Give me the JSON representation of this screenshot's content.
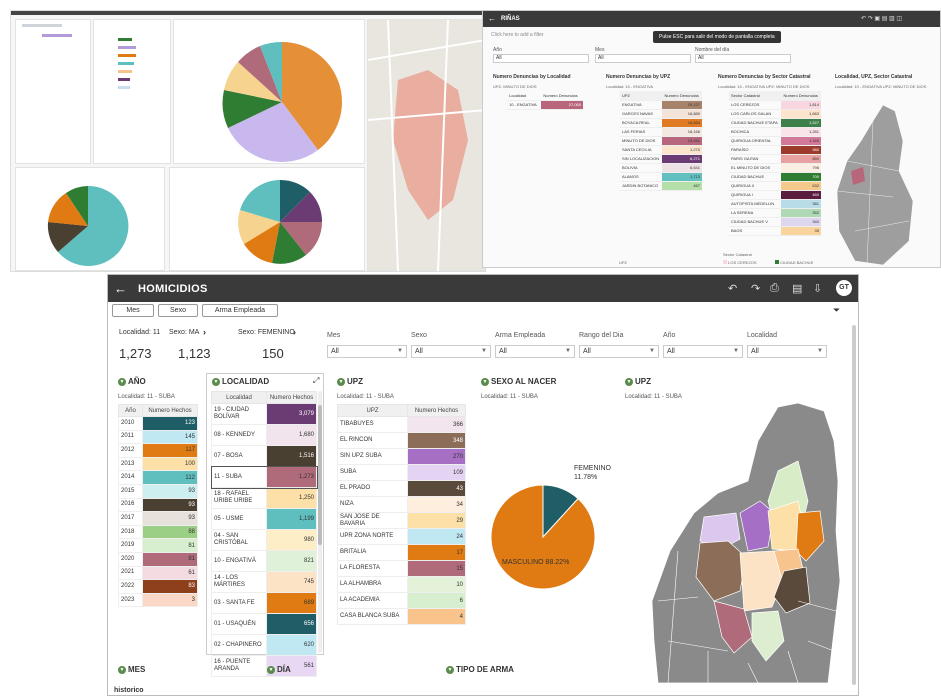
{
  "rinas": {
    "title": "RIÑAS",
    "tooltip": "Pulse ESC para salir del modo de pantalla completa",
    "add_filter": "Click here to add a filter",
    "filters": [
      {
        "label": "Año",
        "value": "All"
      },
      {
        "label": "Mes",
        "value": "All"
      },
      {
        "label": "Nombre del día",
        "value": "All"
      }
    ],
    "localidad": {
      "heading": "Numero Denuncias by Localidad",
      "sub": "UPZ: MINUTO DE DIOS",
      "cols": [
        "Localidad",
        "Numero Denuncias"
      ],
      "rows": [
        {
          "name": "10 - ENGATIVA",
          "value": "27,065",
          "color": "#b8667b"
        }
      ]
    },
    "upz": {
      "heading": "Numero Denuncias by UPZ",
      "sub": "Localidad: 10 - ENGATIVA",
      "cols": [
        "UPZ",
        "Numero Denuncias"
      ],
      "rows": [
        {
          "name": "ENGATIVA",
          "value": "20,127",
          "color": "#a8836b"
        },
        {
          "name": "GARCES NAVAS",
          "value": "16,880",
          "color": "#f3e3d8"
        },
        {
          "name": "BOYACA REAL",
          "value": "16,664",
          "color": "#e07b23"
        },
        {
          "name": "LAS FERIAS",
          "value": "18,166",
          "color": "#f4e9e2"
        },
        {
          "name": "MINUTO DE DIOS",
          "value": "13,041",
          "color": "#b8667b"
        },
        {
          "name": "SANTA CECILIA",
          "value": "1,270",
          "color": "#fbe5cc"
        },
        {
          "name": "SIN LOCALIZACION",
          "value": "6,271",
          "color": "#6b3b74"
        },
        {
          "name": "BOLIVIA",
          "value": "6,641",
          "color": "#efe2e6"
        },
        {
          "name": "ALAMOS",
          "value": "1,713",
          "color": "#62c0c0"
        },
        {
          "name": "JARDIN BOTANICO",
          "value": "467",
          "color": "#b4dfa9"
        }
      ]
    },
    "sector": {
      "heading": "Numero Denuncias by Sector Catastral",
      "sub": "Localidad: 10 - ENGATIVA   UPZ: MINUTO DE DIOS",
      "cols": [
        "Sector Catastral",
        "Numero Denuncias"
      ],
      "rows": [
        {
          "name": "LOS CEREZOS",
          "value": "1,814",
          "color": "#f8d7e0"
        },
        {
          "name": "LOS CARLOS GALAN",
          "value": "1,663",
          "color": "#fde4cc"
        },
        {
          "name": "CIUDAD BACHUE ETAPA",
          "value": "1,527",
          "color": "#3f7f4a"
        },
        {
          "name": "BOCHICA",
          "value": "1,281",
          "color": "#fae3e9"
        },
        {
          "name": "QUIRIGUA ORIENTAL",
          "value": "1,165",
          "color": "#d4789a"
        },
        {
          "name": "PARAÍSO",
          "value": "980",
          "color": "#9c3a2c"
        },
        {
          "name": "PARIS GAITAN",
          "value": "850",
          "color": "#e8a1a1"
        },
        {
          "name": "EL MINUTO DE DIOS",
          "value": "796",
          "color": "#fbeee2"
        },
        {
          "name": "CIUDAD BACHUE",
          "value": "700",
          "color": "#2e7d32"
        },
        {
          "name": "QUIRIGUA II",
          "value": "632",
          "color": "#f5c98a"
        },
        {
          "name": "QUIRIGUA I",
          "value": "460",
          "color": "#5a1c3f"
        },
        {
          "name": "AUTOPISTA MEDELLIN",
          "value": "381",
          "color": "#b9dde8"
        },
        {
          "name": "LA SERENA",
          "value": "352",
          "color": "#aed9b4"
        },
        {
          "name": "CIUDAD BACHUE V",
          "value": "340",
          "color": "#ddd6ee"
        },
        {
          "name": "BAGS",
          "value": "35",
          "color": "#f9d49d"
        }
      ]
    },
    "map_heading": "Localidad, UPZ, Sector Catastral",
    "map_sub": "Localidad: 10 - ENGATIVA   UPZ: MINUTO DE DIOS",
    "legend_title": "Sector Catastral",
    "legend_items": [
      {
        "label": "LOS CEREZOS",
        "color": "#f8d7e0"
      },
      {
        "label": "CIUDAD BACHUE",
        "color": "#2e7d32"
      }
    ],
    "upz_footer": "UPZ"
  },
  "homicidios": {
    "title": "HOMICIDIOS",
    "filter_buttons": [
      "Mes",
      "Sexo",
      "Arma Empleada"
    ],
    "kpis": [
      {
        "label": "Localidad: 11",
        "value": "1,273"
      },
      {
        "label": "Sexo: MA",
        "value": "1,123"
      },
      {
        "label": "Sexo: FEMENINO",
        "value": "150"
      }
    ],
    "filters": [
      {
        "label": "Mes",
        "value": "All"
      },
      {
        "label": "Sexo",
        "value": "All"
      },
      {
        "label": "Arma Empleada",
        "value": "All"
      },
      {
        "label": "Rango del Dia",
        "value": "All"
      },
      {
        "label": "Año",
        "value": "All"
      },
      {
        "label": "Localidad",
        "value": "All"
      }
    ],
    "anio": {
      "heading": "AÑO",
      "sub": "Localidad: 11 - SUBA",
      "cols": [
        "Año",
        "Numero Hechos"
      ],
      "rows": [
        {
          "name": "2010",
          "value": "123",
          "color": "#1f5e66"
        },
        {
          "name": "2011",
          "value": "145",
          "color": "#bfe8f3"
        },
        {
          "name": "2012",
          "value": "117",
          "color": "#e07b13"
        },
        {
          "name": "2013",
          "value": "100",
          "color": "#fde0a8"
        },
        {
          "name": "2014",
          "value": "112",
          "color": "#5fbfbf"
        },
        {
          "name": "2015",
          "value": "93",
          "color": "#cdeff0"
        },
        {
          "name": "2016",
          "value": "93",
          "color": "#4a4031"
        },
        {
          "name": "2017",
          "value": "93",
          "color": "#e8e2dc"
        },
        {
          "name": "2018",
          "value": "88",
          "color": "#9ccf86"
        },
        {
          "name": "2019",
          "value": "81",
          "color": "#d8efcf"
        },
        {
          "name": "2020",
          "value": "81",
          "color": "#b06b7a"
        },
        {
          "name": "2021",
          "value": "61",
          "color": "#f3dbe1"
        },
        {
          "name": "2022",
          "value": "83",
          "color": "#8e3f1c"
        },
        {
          "name": "2023",
          "value": "3",
          "color": "#fbd8c6"
        }
      ]
    },
    "localidad": {
      "heading": "LOCALIDAD",
      "cols": [
        "Localidad",
        "Numero Hechos"
      ],
      "rows": [
        {
          "name": "19 - CIUDAD BOLÍVAR",
          "value": "3,079",
          "color": "#6b3b74"
        },
        {
          "name": "08 - KENNEDY",
          "value": "1,680",
          "color": "#f1e4ec"
        },
        {
          "name": "07 - BOSA",
          "value": "1,516",
          "color": "#4a4031"
        },
        {
          "name": "11 - SUBA",
          "value": "1,273",
          "color": "#b06b7a"
        },
        {
          "name": "18 - RAFAEL URIBE URIBE",
          "value": "1,250",
          "color": "#fde0a8"
        },
        {
          "name": "05 - USME",
          "value": "1,199",
          "color": "#5fbfbf"
        },
        {
          "name": "04 - SAN CRISTÓBAL",
          "value": "980",
          "color": "#fdeec7"
        },
        {
          "name": "10 - ENGATIVÁ",
          "value": "821",
          "color": "#dff1d8"
        },
        {
          "name": "14 - LOS MÁRTIRES",
          "value": "745",
          "color": "#fde3c6"
        },
        {
          "name": "03 - SANTA FE",
          "value": "689",
          "color": "#e07b13"
        },
        {
          "name": "01 - USAQUÉN",
          "value": "656",
          "color": "#1f5e66"
        },
        {
          "name": "02 - CHAPINERO",
          "value": "620",
          "color": "#bfe8f3"
        },
        {
          "name": "16 - PUENTE ARANDA",
          "value": "561",
          "color": "#e8d8f3"
        }
      ]
    },
    "upz": {
      "heading": "UPZ",
      "sub": "Localidad: 11 - SUBA",
      "cols": [
        "UPZ",
        "Numero Hechos"
      ],
      "rows": [
        {
          "name": "TIBABUYES",
          "value": "366",
          "color": "#f2e5ee"
        },
        {
          "name": "EL RINCON",
          "value": "348",
          "color": "#8b6d58"
        },
        {
          "name": "SIN UPZ SUBA",
          "value": "270",
          "color": "#a66fc4"
        },
        {
          "name": "SUBA",
          "value": "109",
          "color": "#e5d3f3"
        },
        {
          "name": "EL PRADO",
          "value": "43",
          "color": "#5a4a3c"
        },
        {
          "name": "NIZA",
          "value": "34",
          "color": "#fdeede"
        },
        {
          "name": "SAN JOSE DE BAVARIA",
          "value": "29",
          "color": "#fde0a8"
        },
        {
          "name": "UPR ZONA NORTE",
          "value": "24",
          "color": "#bfe8f3"
        },
        {
          "name": "BRITALIA",
          "value": "17",
          "color": "#e07b13"
        },
        {
          "name": "LA FLORESTA",
          "value": "15",
          "color": "#b06b7a"
        },
        {
          "name": "LA ALHAMBRA",
          "value": "10",
          "color": "#e3f2d8"
        },
        {
          "name": "LA ACADEMIA",
          "value": "6",
          "color": "#d8efcf"
        },
        {
          "name": "CASA BLANCA SUBA",
          "value": "4",
          "color": "#f9c48c"
        }
      ]
    },
    "sexo": {
      "heading": "SEXO AL NACER",
      "sub": "Localidad: 11 - SUBA"
    },
    "map_heading": "UPZ",
    "map_sub": "Localidad: 11 - SUBA",
    "bottom_sections": [
      "MES",
      "DÍA",
      "TIPO DE ARMA"
    ],
    "footer": "historico"
  },
  "chart_data": {
    "type": "pie",
    "slices": [
      {
        "label": "MASCULINO",
        "pct_label": "88.22%",
        "value": 88.22,
        "color": "#e07b13"
      },
      {
        "label": "FEMENINO",
        "pct_label": "11.78%",
        "value": 11.78,
        "color": "#1f5e66"
      }
    ]
  }
}
